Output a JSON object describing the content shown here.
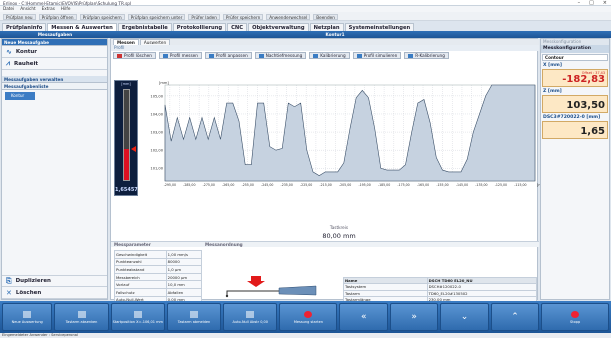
{
  "window": {
    "title": "Erlinox - C:\\Hommel-Etamic\\EVOVIS\\Prüfplan\\Schulung TR.spl"
  },
  "menubar": [
    "Datei",
    "Ansicht",
    "Extras",
    "Hilfe"
  ],
  "toolbar": [
    "Prüfplan neu",
    "Prüfplan öffnen",
    "Prüfplan speichern",
    "Prüfplan speichern unter",
    "Prüfer laden",
    "Prüfer speichern",
    "Anwenderwechsel",
    "Beenden"
  ],
  "tabs": [
    "Prüfplaninfo",
    "Messen & Auswerten",
    "Ergebnistabelle",
    "Protokollierung",
    "CNC",
    "Objektverwaltung",
    "Netzplan",
    "Systemeinstellungen"
  ],
  "active_tab": 1,
  "header": {
    "left": "Messaufgaben",
    "center": "Kontur1"
  },
  "sidebar": {
    "new_head": "Neue Messaufgabe",
    "buttons": [
      {
        "label": "Kontur",
        "icon": "contour-icon"
      },
      {
        "label": "Rauheit",
        "icon": "roughness-icon"
      }
    ],
    "manage_head": "Messaufgaben verwalten",
    "list_head": "Messaufgabenliste",
    "list_items": [
      "Kontur"
    ],
    "footer_buttons": [
      {
        "label": "Duplizieren",
        "icon": "duplicate-icon"
      },
      {
        "label": "Löschen",
        "icon": "delete-icon"
      }
    ]
  },
  "main": {
    "subtabs": [
      "Messen",
      "Auswerten"
    ],
    "profil_label": "Profil",
    "profile_buttons": [
      "Profil löschen",
      "Profil messen",
      "Profil anpassen",
      "Nachtiefmessung",
      "Kalibrierung",
      "Profil simulieren",
      "R-Kalibrierung"
    ],
    "gauge": {
      "unit": "[mm]",
      "value": "1,65457",
      "level": 0.35
    },
    "position_label": "Tastkreis",
    "position_value": "80,00 mm",
    "measure_params_label": "Messparameter",
    "setup_label": "Messanordnung",
    "params": [
      [
        "Geschwindigkeit",
        "1,00 mm/s"
      ],
      [
        "Punkteanzahl",
        "80000"
      ],
      [
        "Punkteabstand",
        "1,0 µm"
      ],
      [
        "Messbereich",
        "20000 µm"
      ],
      [
        "Vorlauf",
        "10,0 mm"
      ],
      [
        "Fallschutz",
        "Abfallen"
      ],
      [
        "Auto-Null-Wert",
        "0,00 mm"
      ]
    ],
    "probe": [
      [
        "Name",
        "DSCH TD60 EL20_NU"
      ],
      [
        "Tastsystem",
        "DSCH#120022-0"
      ],
      [
        "Tastarm",
        "TD60_EL20#130502"
      ],
      [
        "Tastarmlänge",
        "230,00 mm"
      ],
      [
        "Tastspitzenradius",
        "0,010 mm"
      ],
      [
        "Antastnummer",
        "10057500"
      ],
      [
        "Seriennummer",
        "Beliebig"
      ]
    ]
  },
  "chart_data": {
    "type": "line",
    "x": [
      -30.0,
      -29.5,
      -29.0,
      -28.5,
      -28.0,
      -27.5,
      -27.0,
      -26.5,
      -26.0,
      -25.5,
      -25.0,
      -24.5,
      -24.0,
      -23.5,
      -23.0,
      -22.5,
      -22.0,
      -21.5,
      -21.0,
      -20.5,
      -20.0,
      -19.5,
      -19.0,
      -18.5,
      -18.0,
      -17.5,
      -17.0,
      -16.5,
      -16.0,
      -15.5,
      -15.0,
      -14.5,
      -14.0,
      -13.5,
      -13.0,
      -12.5,
      -12.0,
      -11.5,
      -11.0,
      -10.5,
      -10.0,
      -9.5,
      -9.0,
      -8.5,
      -8.0,
      -7.5,
      -7.0,
      -6.5,
      -6.0,
      -5.5,
      -5.0,
      -4.5,
      -4.0,
      -3.5,
      -3.0,
      -2.5,
      -2.0,
      -1.5,
      -1.0,
      -0.5,
      0.0
    ],
    "y": [
      104.5,
      102.5,
      103.8,
      102.6,
      103.8,
      102.6,
      103.8,
      102.6,
      103.8,
      102.6,
      104.6,
      104.6,
      103.6,
      101.2,
      101.2,
      104.6,
      104.6,
      102.2,
      102.0,
      102.1,
      104.6,
      104.4,
      104.6,
      102.0,
      100.8,
      100.6,
      100.8,
      100.8,
      100.8,
      101.3,
      103.2,
      104.9,
      105.3,
      104.9,
      103.2,
      101.0,
      100.9,
      100.9,
      100.9,
      101.2,
      103.0,
      104.6,
      104.8,
      103.5,
      101.6,
      100.9,
      100.8,
      100.8,
      100.8,
      101.5,
      103.0,
      104.0,
      105.0,
      105.6,
      105.6,
      105.6,
      105.6,
      105.6,
      105.6,
      105.6,
      105.6
    ],
    "xlim": [
      -30,
      0
    ],
    "ylim": [
      100.3,
      105.6
    ],
    "xticks": [
      "-295,00",
      "-290,00",
      "-285,00",
      "-280,00",
      "-275,00",
      "-270,00",
      "-265,00",
      "-260,00",
      "-255,00",
      "-250,00",
      "-245,00",
      "-240,00",
      "-235,00",
      "-230,00",
      "-225,00",
      "-220,00",
      "-215,00",
      "-210,00",
      "-205,00",
      "-200,00",
      "-195,00",
      "-190,00",
      "-185,00",
      "-180,00",
      "-175,00",
      "-170,00",
      "-165,00",
      "-160,00",
      "-155,00",
      "-150,00",
      "-145,00",
      "-140,00",
      "-135,00",
      "-130,00",
      "-125,00",
      "-120,00",
      "-115,00",
      "-110,00"
    ],
    "yticks": [
      "105,00",
      "104,00",
      "103,00",
      "102,00",
      "101,00"
    ],
    "ylabel": "[mm]",
    "xlabel": "[mm]"
  },
  "rpanel": {
    "head": "Messkonfiguration",
    "config": "Messkonfiguration",
    "contour": "Contour",
    "x_label": "X [mm]",
    "x_offset": "Offset : 37,43",
    "x_value": "-182,83",
    "z_label": "Z [mm]",
    "z_value": "103,50",
    "probe_label": "DSC3#720022-0 [mm]",
    "probe_value": "1,65"
  },
  "bottombar": [
    {
      "label": "Neue Auswertung",
      "icon": "new-eval-icon"
    },
    {
      "label": "Tastarm absenken",
      "icon": "lower-probe-icon"
    },
    {
      "label": "Startposition X=-106,01 mm",
      "icon": "start-pos-icon"
    },
    {
      "label": "Tastarm abmelden",
      "icon": "unlink-probe-icon"
    },
    {
      "label": "Auto-Null Abstr 0,00",
      "icon": "auto-zero-icon"
    },
    {
      "label": "Messung starten",
      "icon": "start-measure-icon"
    },
    {
      "label": "",
      "icon": "fast-left-icon",
      "glyph": "«"
    },
    {
      "label": "",
      "icon": "fast-right-icon",
      "glyph": "»"
    },
    {
      "label": "",
      "icon": "down-icon",
      "glyph": "⌄"
    },
    {
      "label": "",
      "icon": "up-icon",
      "glyph": "⌃"
    },
    {
      "label": "Stopp",
      "icon": "stop-icon"
    }
  ],
  "status": "Eingemeldeter Anwender : Serviceperonal"
}
